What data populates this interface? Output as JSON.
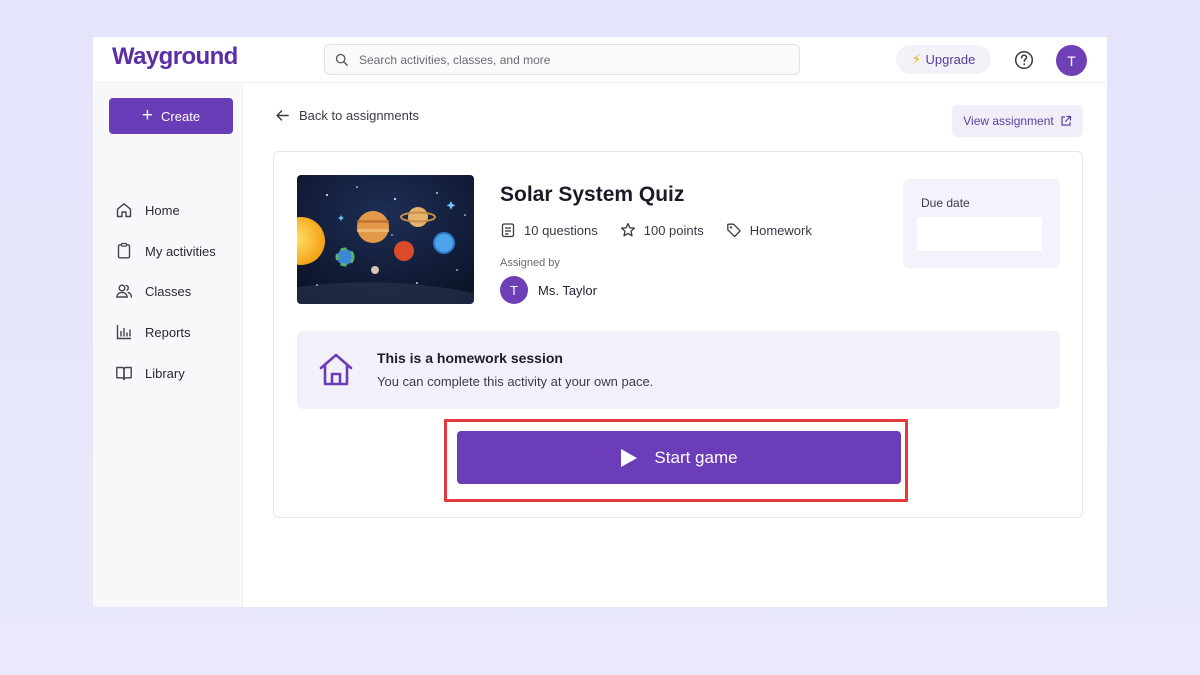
{
  "brand": {
    "name": "Wayground",
    "color": "#5b2ea6"
  },
  "search": {
    "placeholder": "Search activities, classes, and more"
  },
  "header": {
    "upgrade_label": "Upgrade",
    "user_initial": "T"
  },
  "sidebar": {
    "create_label": "Create",
    "items": [
      {
        "label": "Home",
        "icon": "home-icon"
      },
      {
        "label": "My activities",
        "icon": "clipboard-icon"
      },
      {
        "label": "Classes",
        "icon": "users-icon"
      },
      {
        "label": "Reports",
        "icon": "bar-chart-icon"
      },
      {
        "label": "Library",
        "icon": "book-icon"
      }
    ]
  },
  "main": {
    "back_label": "Back to assignments",
    "view_assignment_label": "View assignment",
    "quiz": {
      "title": "Solar System Quiz",
      "questions": "10 questions",
      "points": "100 points",
      "type": "Homework",
      "assigned_by_label": "Assigned by",
      "teacher_name": "Ms. Taylor",
      "teacher_initial": "T"
    },
    "due": {
      "label": "Due date",
      "value": ""
    },
    "session": {
      "title": "This is a homework session",
      "description": "You can complete this activity at your own pace."
    },
    "start_label": "Start game"
  },
  "colors": {
    "accent": "#6b3db9",
    "highlight": "#e23b3b"
  }
}
